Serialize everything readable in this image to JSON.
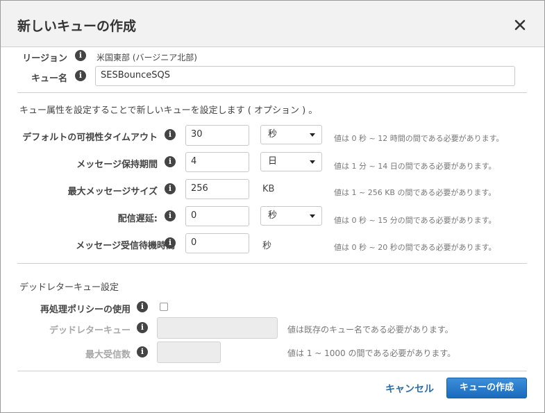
{
  "dialog": {
    "title": "新しいキューの作成",
    "close_icon": "close-icon"
  },
  "region": {
    "label": "リージョン",
    "value": "米国東部 (バージニア北部)"
  },
  "queue_name": {
    "label": "キュー名",
    "value": "SESBounceSQS"
  },
  "attributes": {
    "intro": "キュー属性を設定することで新しいキューを設定します ( オプション ) 。",
    "visibility_timeout": {
      "label": "デフォルトの可視性タイムアウト",
      "value": "30",
      "unit": "秒",
      "hint": "値は 0 秒 ~ 12 時間の間である必要があります。"
    },
    "retention_period": {
      "label": "メッセージ保持期間",
      "value": "4",
      "unit": "日",
      "hint": "値は 1 分 ~ 14 日の間である必要があります。"
    },
    "max_message_size": {
      "label": "最大メッセージサイズ",
      "value": "256",
      "unit": "KB",
      "hint": "値は 1 ~ 256 KB の間である必要があります。"
    },
    "delivery_delay": {
      "label": "配信遅延:",
      "value": "0",
      "unit": "秒",
      "hint": "値は 0 秒 ~ 15 分の間である必要があります。"
    },
    "receive_wait_time": {
      "label": "メッセージ受信待機時間",
      "value": "0",
      "unit": "秒",
      "hint": "値は 0 秒 ~ 20 秒の間である必要があります。"
    }
  },
  "dead_letter": {
    "section_title": "デッドレターキュー設定",
    "redrive_policy": {
      "label": "再処理ポリシーの使用",
      "checked": false
    },
    "dlq_name": {
      "label": "デッドレターキュー",
      "value": "",
      "hint": "値は既存のキュー名である必要があります。"
    },
    "max_receives": {
      "label": "最大受信数",
      "value": "",
      "hint": "値は 1 ~ 1000 の間である必要があります。"
    }
  },
  "footer": {
    "cancel_label": "キャンセル",
    "create_label": "キューの作成"
  },
  "colors": {
    "primary": "#1f74c6",
    "link": "#2f6ea5"
  }
}
